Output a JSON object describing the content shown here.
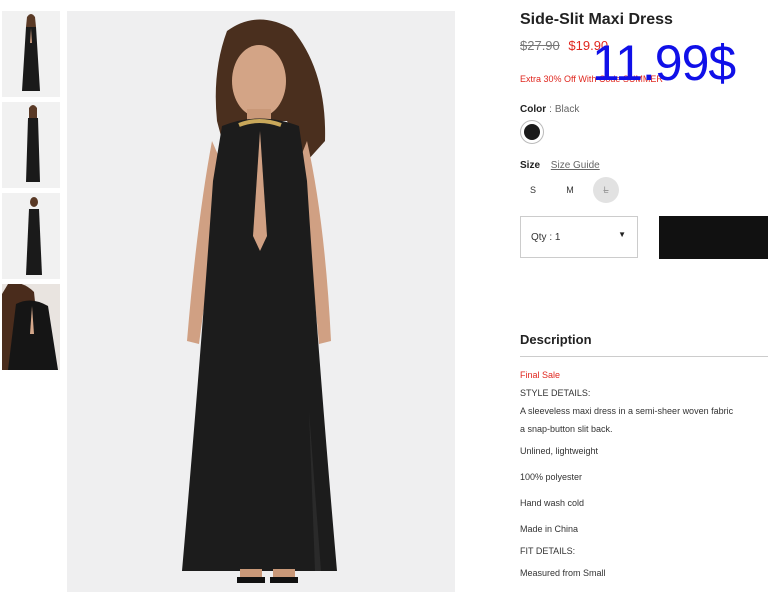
{
  "product": {
    "title": "Side-Slit Maxi Dress",
    "old_price": "$27.90",
    "new_price": "$19.90",
    "overlay_price": "11.99$",
    "promo_text": "Extra 30% Off With Code SUMMER"
  },
  "color": {
    "label": "Color",
    "separator": ":",
    "selected": "Black",
    "swatch_hex": "#1b1b1b"
  },
  "size": {
    "label": "Size",
    "guide_link": "Size Guide",
    "options": [
      "S",
      "M",
      "L"
    ],
    "unavailable": "L"
  },
  "quantity": {
    "label": "Qty : 1",
    "caret": "▼"
  },
  "description": {
    "heading": "Description",
    "final_sale": "Final Sale",
    "style_heading": "STYLE DETAILS:",
    "line1": "A sleeveless maxi dress in a semi-sheer woven fabric",
    "line2": "a snap-button slit back.",
    "bullets": [
      "Unlined, lightweight",
      "100% polyester",
      "Hand wash cold",
      "Made in China"
    ],
    "fit_heading": "FIT DETAILS:",
    "fit_line": "Measured from Small"
  },
  "colors": {
    "sale_red": "#e0271f",
    "overlay_blue": "#1010e8",
    "button_black": "#111111"
  }
}
